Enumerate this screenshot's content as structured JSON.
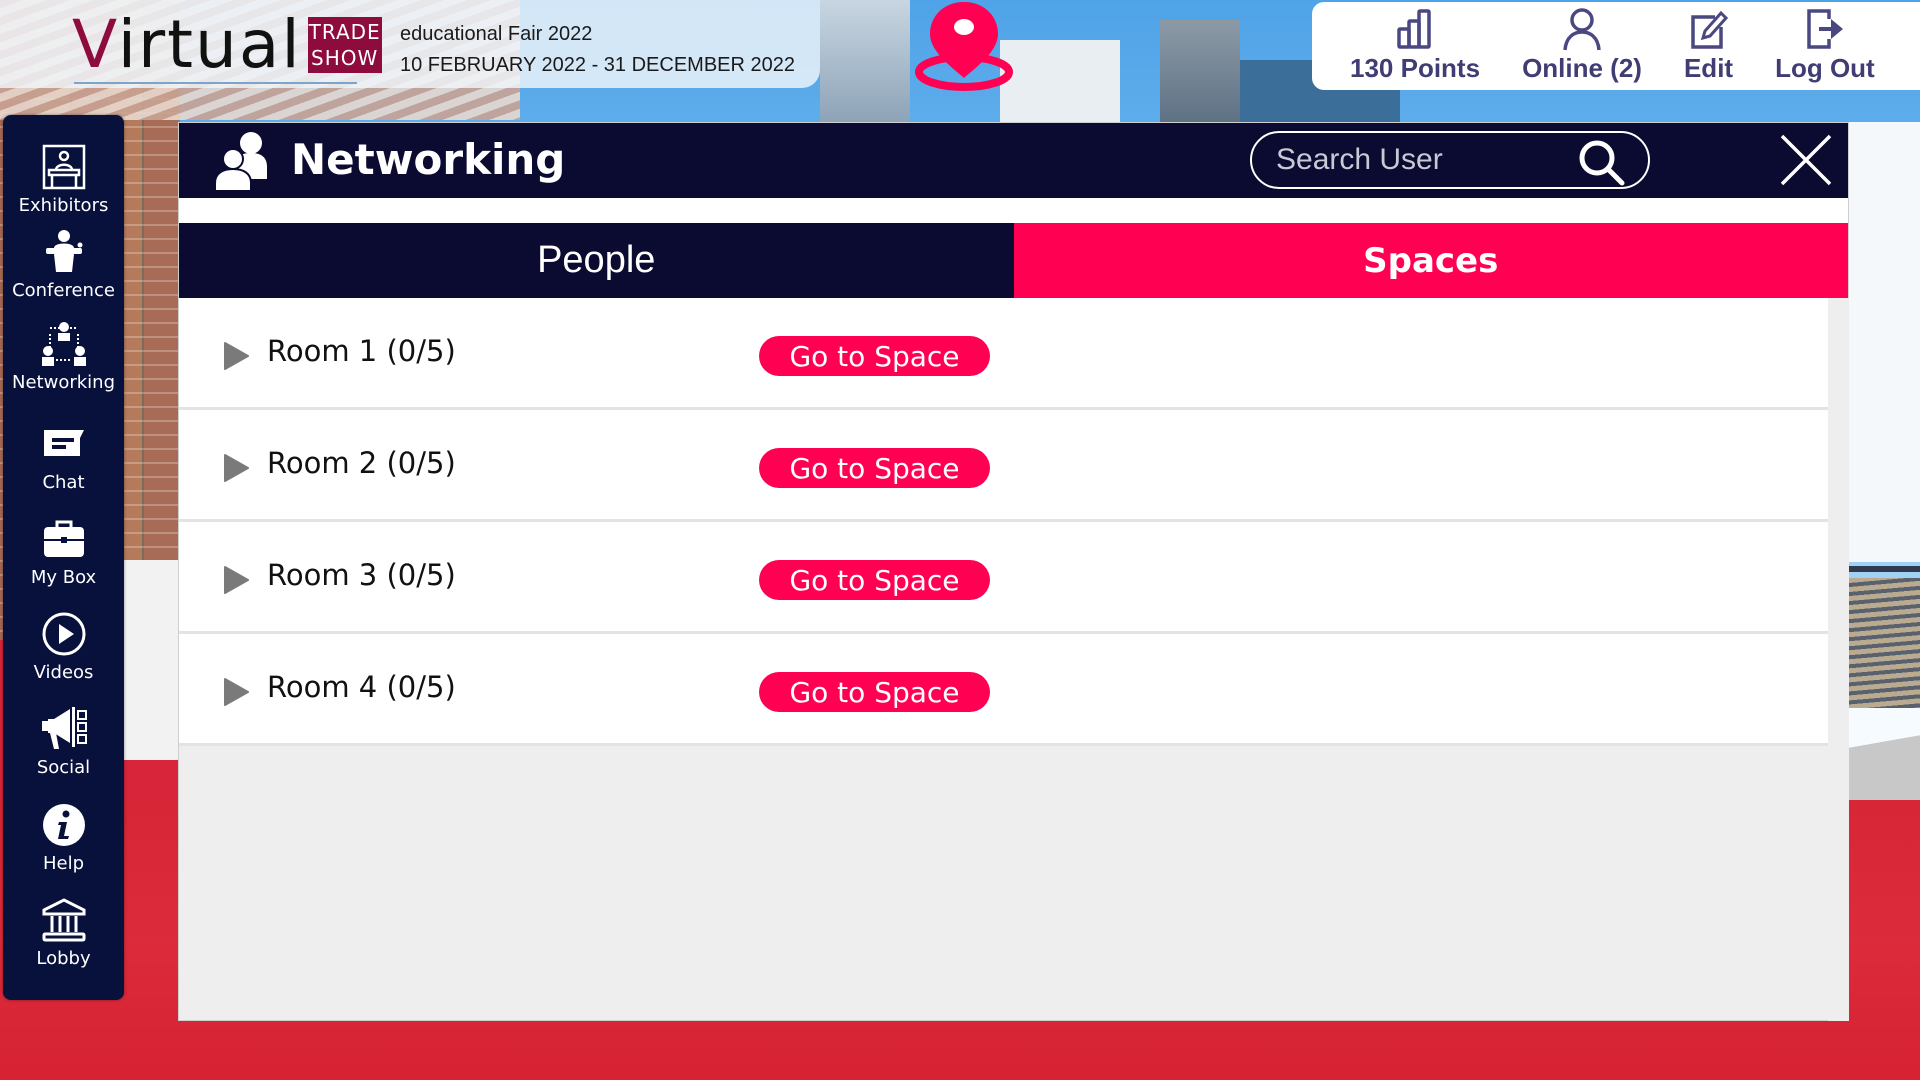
{
  "banner": {
    "logo_main": "Virtual",
    "logo_box_line1": "TRADE",
    "logo_box_line2": "SHOW",
    "event_name": "educational Fair 2022",
    "event_dates": "10 FEBRUARY 2022 - 31 DECEMBER 2022"
  },
  "map_pin": {
    "icon": "location-pin-icon",
    "color": "#ff0052"
  },
  "toolbar": {
    "items": [
      {
        "label": "130 Points",
        "icon": "bar-chart-icon"
      },
      {
        "label": "Online (2)",
        "icon": "user-icon"
      },
      {
        "label": "Edit",
        "icon": "edit-icon"
      },
      {
        "label": "Log Out",
        "icon": "logout-icon"
      }
    ]
  },
  "sidebar": {
    "items": [
      {
        "label": "Exhibitors",
        "icon": "exhibitor-booth-icon"
      },
      {
        "label": "Conference",
        "icon": "podium-speaker-icon"
      },
      {
        "label": "Networking",
        "icon": "network-people-icon"
      },
      {
        "label": "Chat",
        "icon": "chat-bubble-icon"
      },
      {
        "label": "My Box",
        "icon": "briefcase-icon"
      },
      {
        "label": "Videos",
        "icon": "play-circle-icon"
      },
      {
        "label": "Social",
        "icon": "megaphone-icon"
      },
      {
        "label": "Help",
        "icon": "info-icon"
      },
      {
        "label": "Lobby",
        "icon": "bank-building-icon"
      }
    ]
  },
  "panel": {
    "title": "Networking",
    "search_placeholder": "Search User",
    "search_value": "",
    "tabs": [
      {
        "label": "People",
        "active": false
      },
      {
        "label": "Spaces",
        "active": true
      }
    ],
    "rooms": [
      {
        "name": "Room 1 (0/5)",
        "action": "Go to Space"
      },
      {
        "name": "Room 2 (0/5)",
        "action": "Go to Space"
      },
      {
        "name": "Room 3 (0/5)",
        "action": "Go to Space"
      },
      {
        "name": "Room 4 (0/5)",
        "action": "Go to Space"
      }
    ]
  },
  "colors": {
    "accent": "#ff0052",
    "navy": "#0b0a30",
    "sidebar_bg": "#08103c",
    "toolbar_text": "#3f3d74",
    "logo_maroon": "#8e0b3d"
  }
}
